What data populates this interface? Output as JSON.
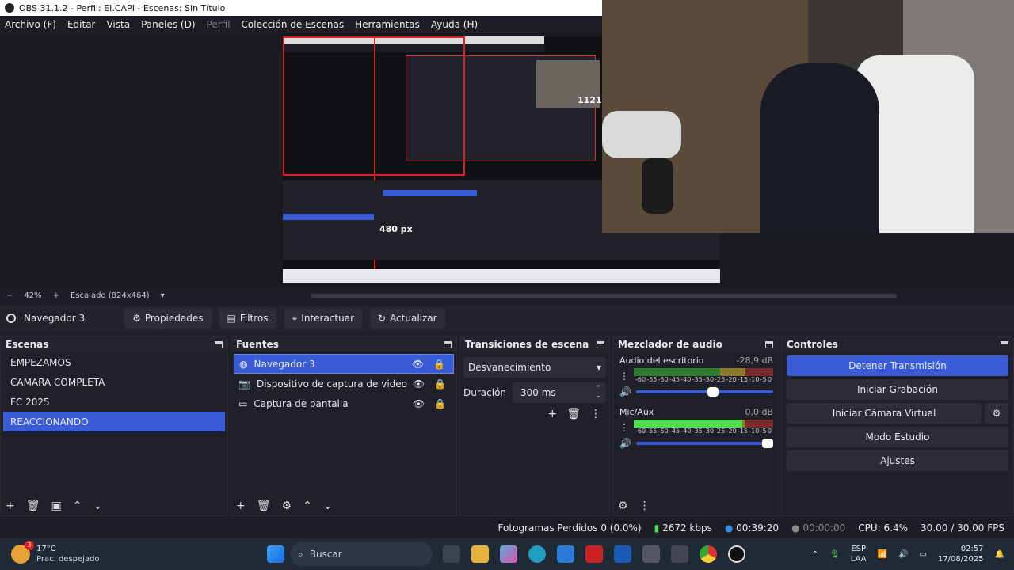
{
  "titlebar": {
    "title": "OBS 31.1.2 - Perfil: EI.CAPI - Escenas: Sin Título"
  },
  "menu": [
    "Archivo (F)",
    "Editar",
    "Vista",
    "Paneles (D)",
    "Perfil",
    "Colección de Escenas",
    "Herramientas",
    "Ayuda (H)"
  ],
  "preview": {
    "size_label_right": "1121 px",
    "size_label_bottom": "480 px"
  },
  "zoom": {
    "minus": "−",
    "percent": "42%",
    "plus": "+",
    "mode": "Escalado (824x464)"
  },
  "source_toolbar": {
    "source_name": "Navegador 3",
    "properties": "Propiedades",
    "filters": "Filtros",
    "interact": "Interactuar",
    "refresh": "Actualizar"
  },
  "scenes": {
    "title": "Escenas",
    "items": [
      {
        "label": "EMPEZAMOS",
        "selected": false
      },
      {
        "label": "CAMARA COMPLETA",
        "selected": false
      },
      {
        "label": "FC 2025",
        "selected": false
      },
      {
        "label": "REACCIONANDO",
        "selected": true
      }
    ]
  },
  "sources": {
    "title": "Fuentes",
    "items": [
      {
        "label": "Navegador 3",
        "icon": "globe-icon",
        "selected": true
      },
      {
        "label": "Dispositivo de captura de video",
        "icon": "camera-icon",
        "selected": false
      },
      {
        "label": "Captura de pantalla",
        "icon": "monitor-icon",
        "selected": false
      }
    ]
  },
  "transitions": {
    "title": "Transiciones de escena",
    "type": "Desvanecimiento",
    "duration_label": "Duración",
    "duration_value": "300 ms"
  },
  "mixer": {
    "title": "Mezclador de audio",
    "channels": [
      {
        "name": "Audio del escritorio",
        "db": "-28,9 dB",
        "level": 0.0,
        "volume": 0.6
      },
      {
        "name": "Mic/Aux",
        "db": "0,0 dB",
        "level": 0.78,
        "volume": 1.0
      }
    ],
    "scale": [
      "-60",
      "-55",
      "-50",
      "-45",
      "-40",
      "-35",
      "-30",
      "-25",
      "-20",
      "-15",
      "-10",
      "-5",
      "0"
    ]
  },
  "controls": {
    "title": "Controles",
    "stop_stream": "Detener Transmisión",
    "start_record": "Iniciar Grabación",
    "virtual_cam": "Iniciar Cámara Virtual",
    "studio_mode": "Modo Estudio",
    "settings": "Ajustes"
  },
  "status": {
    "dropped": "Fotogramas Perdidos 0 (0.0%)",
    "bitrate": "2672 kbps",
    "stream_time": "00:39:20",
    "rec_time": "00:00:00",
    "cpu": "CPU: 6.4%",
    "fps": "30.00 / 30.00 FPS"
  },
  "taskbar": {
    "weather_temp": "17°C",
    "weather_desc": "Prac. despejado",
    "weather_badge": "3",
    "search": "Buscar",
    "lang_top": "ESP",
    "lang_bottom": "LAA",
    "time": "02:57",
    "date": "17/08/2025"
  },
  "colors": {
    "accent": "#3a5bd6",
    "bg": "#1e1f26",
    "taskbar": "#202a36"
  }
}
